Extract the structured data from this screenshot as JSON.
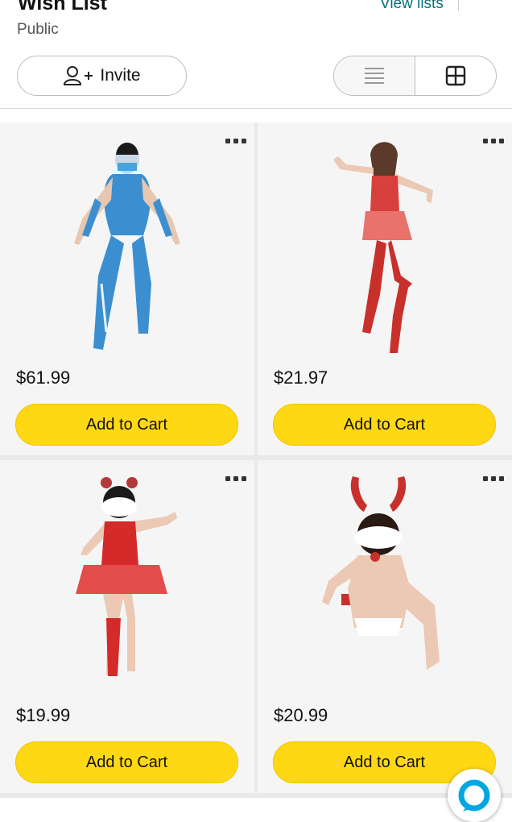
{
  "header": {
    "title": "Wish List",
    "privacy": "Public",
    "view_lists": "View lists",
    "invite_label": "Invite"
  },
  "colors": {
    "accent_link": "#0a6f7a",
    "cart_button": "#ffd814",
    "alexa_blue": "#00a8e1"
  },
  "items": [
    {
      "price": "$61.99",
      "cart_label": "Add to Cart",
      "icon": "costume-blue"
    },
    {
      "price": "$21.97",
      "cart_label": "Add to Cart",
      "icon": "costume-red"
    },
    {
      "price": "$19.99",
      "cart_label": "Add to Cart",
      "icon": "costume-red-skirt"
    },
    {
      "price": "$20.99",
      "cart_label": "Add to Cart",
      "icon": "costume-bunny"
    }
  ]
}
